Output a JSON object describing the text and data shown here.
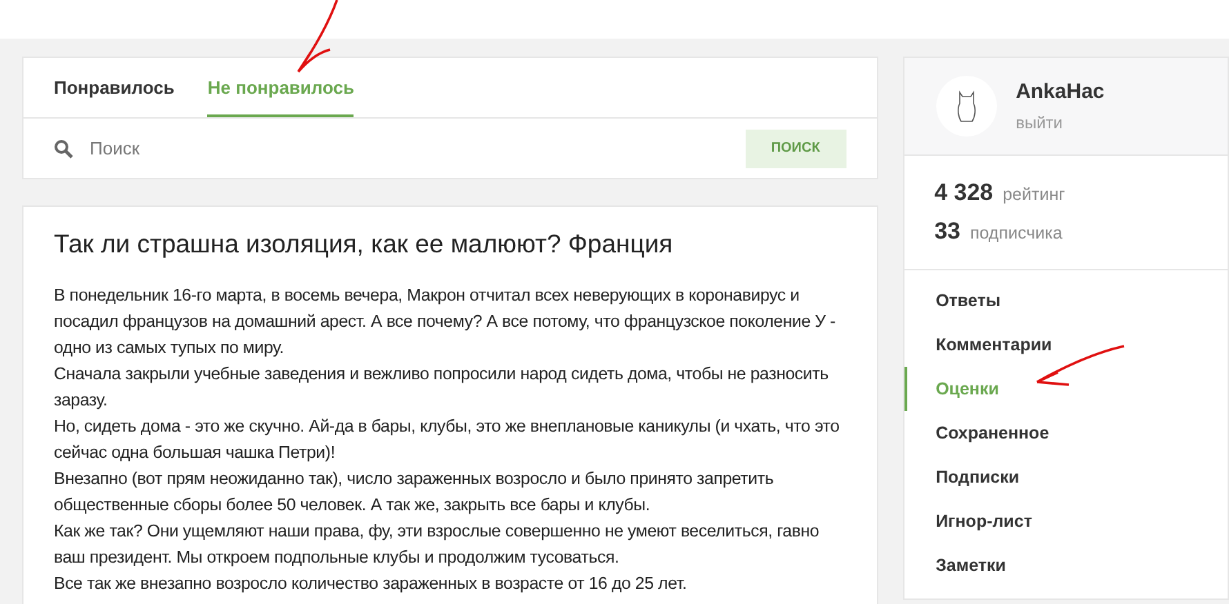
{
  "tabs": [
    {
      "label": "Понравилось",
      "selected": false
    },
    {
      "label": "Не понравилось",
      "selected": true
    }
  ],
  "search": {
    "placeholder": "Поиск",
    "button": "ПОИСК"
  },
  "article": {
    "title": "Так ли страшна изоляция, как ее малюют? Франция",
    "paragraphs": [
      "В понедельник 16-го марта, в восемь вечера, Макрон отчитал всех неверующих в коронавирус и посадил французов на домашний арест. А все почему? А все потому, что французское поколение У - одно из самых тупых по миру.",
      "Сначала закрыли учебные заведения и вежливо попросили народ сидеть дома, чтобы не разносить заразу.",
      "Но, сидеть дома - это же скучно. Ай-да в бары, клубы, это же внеплановые каникулы (и чхать, что это сейчас одна большая чашка Петри)!",
      "Внезапно (вот прям неожиданно так), число зараженных возросло и было принято запретить общественные сборы более 50 человек. А так же, закрыть все бары и клубы.",
      "Как же так? Они ущемляют наши права, фу, эти взрослые совершенно не умеют веселиться, гавно ваш президент. Мы откроем подпольные клубы и продолжим тусоваться.",
      "Все так же внезапно возросло количество зараженных в возрасте от 16 до 25 лет."
    ]
  },
  "profile": {
    "name": "AnkaHac",
    "logout": "выйти",
    "stats": [
      {
        "value": "4 328",
        "label": "рейтинг"
      },
      {
        "value": "33",
        "label": "подписчика"
      }
    ]
  },
  "menu": [
    {
      "label": "Ответы",
      "selected": false
    },
    {
      "label": "Комментарии",
      "selected": false
    },
    {
      "label": "Оценки",
      "selected": true
    },
    {
      "label": "Сохраненное",
      "selected": false
    },
    {
      "label": "Подписки",
      "selected": false
    },
    {
      "label": "Игнор-лист",
      "selected": false
    },
    {
      "label": "Заметки",
      "selected": false
    }
  ]
}
